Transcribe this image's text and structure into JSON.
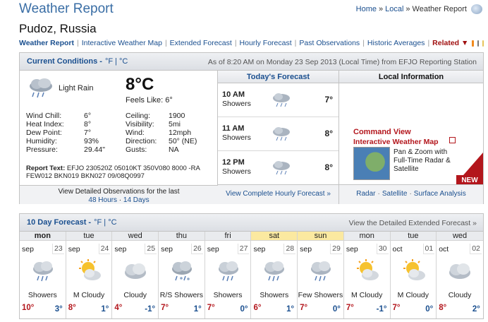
{
  "header": {
    "title": "Weather Report"
  },
  "breadcrumb": {
    "home": "Home",
    "sep1": "»",
    "local": "Local",
    "sep2": "»",
    "current": "Weather Report"
  },
  "city": "Pudoz, Russia",
  "subnav": {
    "items": [
      "Weather Report",
      "Interactive Weather Map",
      "Extended Forecast",
      "Hourly Forecast",
      "Past Observations",
      "Historic Averages"
    ],
    "related": "Related ▼"
  },
  "current": {
    "heading": "Current Conditions -",
    "units": "°F | °C",
    "as_of": "As of 8:20 AM on Monday 23 Sep 2013 (Local Time) from EFJO Reporting Station",
    "condition": "Light Rain",
    "icon": "rain-cloud-icon",
    "temp": "8°C",
    "feels_like": "Feels Like: 6°",
    "left_stats": [
      {
        "k": "Wind Chill:",
        "v": "6°"
      },
      {
        "k": "Heat Index:",
        "v": "8°"
      },
      {
        "k": "Dew Point:",
        "v": "7°"
      },
      {
        "k": "Humidity:",
        "v": "93%"
      },
      {
        "k": "Pressure:",
        "v": "29.44\""
      }
    ],
    "right_stats": [
      {
        "k": "Ceiling:",
        "v": "1900"
      },
      {
        "k": "Visibility:",
        "v": "5mi"
      },
      {
        "k": "Wind:",
        "v": "12mph"
      },
      {
        "k": "Direction:",
        "v": "50° (NE)"
      },
      {
        "k": "Gusts:",
        "v": "NA"
      }
    ],
    "report_label": "Report Text:",
    "report_text": "EFJO 230520Z 05010KT 350V080 8000 -RA FEW012 BKN019 BKN027 09/08Q0997",
    "foot_text": "View Detailed Observations for the last",
    "foot_48": "48 Hours",
    "foot_dot": "·",
    "foot_14": "14 Days"
  },
  "today": {
    "heading": "Today's Forecast",
    "rows": [
      {
        "time": "10 AM",
        "cond": "Showers",
        "temp": "7°"
      },
      {
        "time": "11 AM",
        "cond": "Showers",
        "temp": "8°"
      },
      {
        "time": "12 PM",
        "cond": "Showers",
        "temp": "8°"
      }
    ],
    "foot": "View Complete Hourly Forecast »"
  },
  "local": {
    "heading": "Local Information",
    "cv_title": "Command View",
    "cv_sub": "Interactive Weather Map",
    "cv_desc": "Pan & Zoom with Full-Time Radar & Satellite",
    "new_badge": "NEW",
    "links": [
      "Radar",
      "Satellite",
      "Surface Analysis"
    ]
  },
  "extended": {
    "heading": "10 Day Forecast -",
    "units": "°F | °C",
    "link": "View the Detailed Extended Forecast »",
    "days": [
      {
        "dow": "mon",
        "mon": "sep",
        "date": "23",
        "cond": "Showers",
        "hi": "10°",
        "lo": "3°",
        "icon": "showers-icon"
      },
      {
        "dow": "tue",
        "mon": "sep",
        "date": "24",
        "cond": "M Cloudy",
        "hi": "8°",
        "lo": "1°",
        "icon": "sun-cloud-icon"
      },
      {
        "dow": "wed",
        "mon": "sep",
        "date": "25",
        "cond": "Cloudy",
        "hi": "4°",
        "lo": "-1°",
        "icon": "cloud-icon"
      },
      {
        "dow": "thu",
        "mon": "sep",
        "date": "26",
        "cond": "R/S Showers",
        "hi": "7°",
        "lo": "1°",
        "icon": "rain-snow-icon"
      },
      {
        "dow": "fri",
        "mon": "sep",
        "date": "27",
        "cond": "Showers",
        "hi": "7°",
        "lo": "0°",
        "icon": "showers-icon"
      },
      {
        "dow": "sat",
        "mon": "sep",
        "date": "28",
        "cond": "Showers",
        "hi": "6°",
        "lo": "1°",
        "icon": "showers-icon"
      },
      {
        "dow": "sun",
        "mon": "sep",
        "date": "29",
        "cond": "Few Showers",
        "hi": "7°",
        "lo": "0°",
        "icon": "showers-icon"
      },
      {
        "dow": "mon",
        "mon": "sep",
        "date": "30",
        "cond": "M Cloudy",
        "hi": "7°",
        "lo": "-1°",
        "icon": "sun-cloud-icon"
      },
      {
        "dow": "tue",
        "mon": "oct",
        "date": "01",
        "cond": "M Cloudy",
        "hi": "7°",
        "lo": "0°",
        "icon": "sun-cloud-icon"
      },
      {
        "dow": "wed",
        "mon": "oct",
        "date": "02",
        "cond": "Cloudy",
        "hi": "8°",
        "lo": "2°",
        "icon": "cloud-icon"
      }
    ]
  },
  "colors": {
    "link": "#1a4f8f",
    "accent_red": "#b3161c",
    "weekend": "#fbe9a0"
  }
}
